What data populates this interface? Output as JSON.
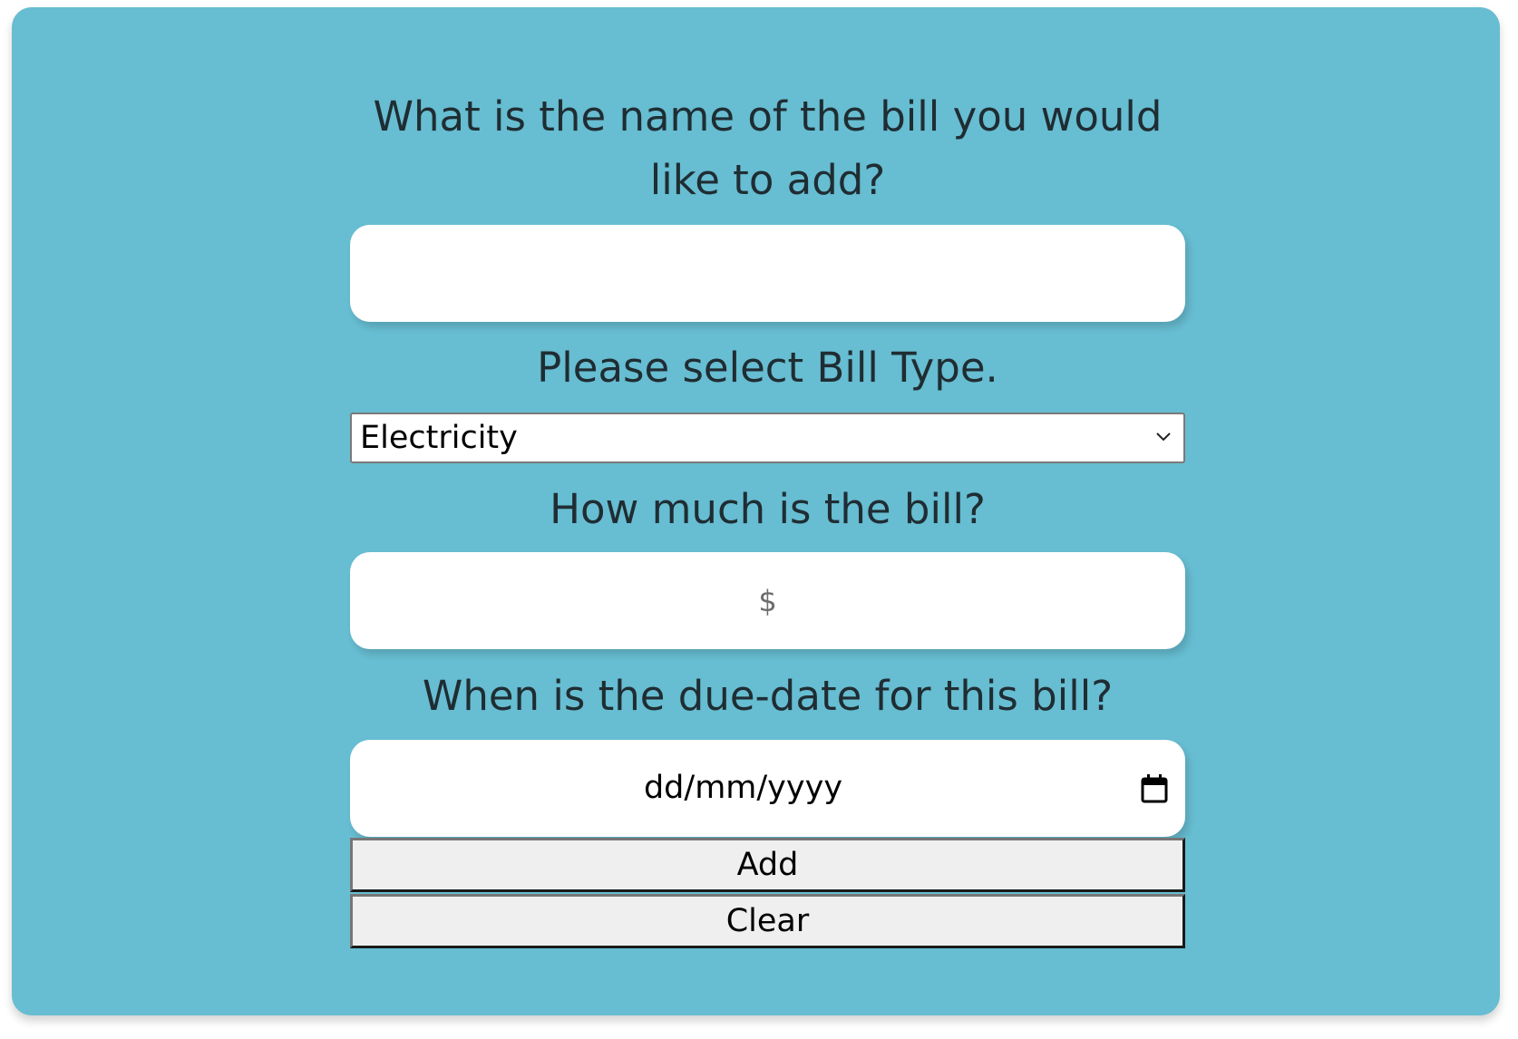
{
  "form": {
    "name_question_line1": "What is the name of the bill you would",
    "name_question_line2": "like to add?",
    "name_input": {
      "value": "",
      "placeholder": ""
    },
    "type_question": "Please select Bill Type.",
    "type_select": {
      "selected": "Electricity"
    },
    "amount_question": "How much is the bill?",
    "amount_input": {
      "value": "",
      "placeholder": "$"
    },
    "date_question": "When is the due-date for this bill?",
    "date_input": {
      "placeholder": "dd/mm/yyyy"
    },
    "add_button_label": "Add",
    "clear_button_label": "Clear"
  },
  "colors": {
    "card_background": "#67bdd1",
    "label_text": "#1f2d33",
    "input_background": "#ffffff",
    "button_background": "#efefef"
  },
  "icons": {
    "select": "chevron-down-icon",
    "date": "calendar-icon"
  }
}
